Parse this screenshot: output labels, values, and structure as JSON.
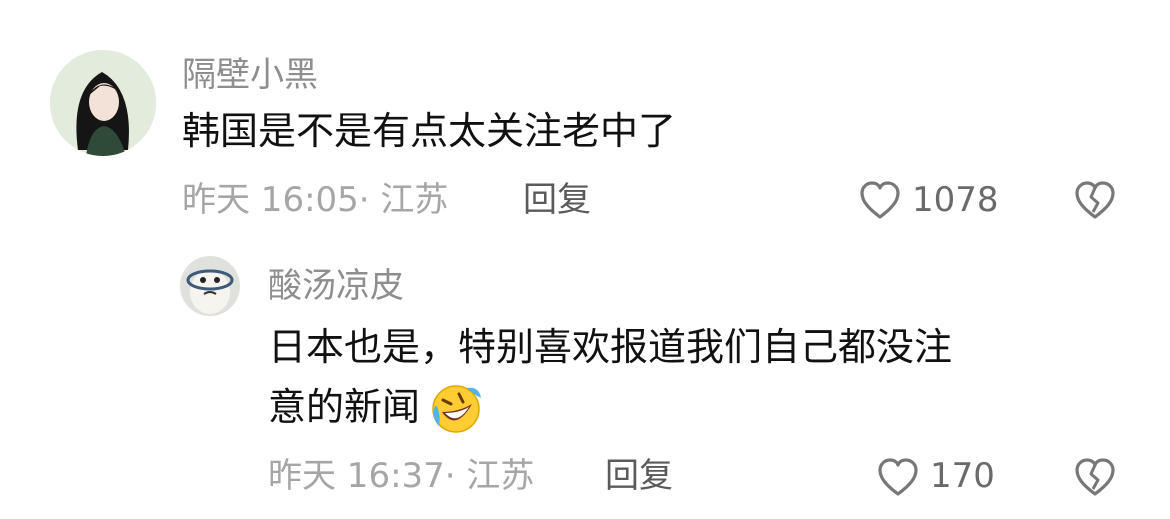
{
  "comments": [
    {
      "username": "隔壁小黑",
      "content": "韩国是不是有点太关注老中了",
      "time": "昨天 16:05",
      "location": "· 江苏",
      "reply_label": "回复",
      "likes": "1078"
    },
    {
      "username": "酸汤凉皮",
      "content_line1": "日本也是，特别喜欢报道我们自己都没注",
      "content_line2": "意的新闻",
      "emoji": "rolling-on-floor-laughing",
      "time": "昨天 16:37",
      "location": "· 江苏",
      "reply_label": "回复",
      "likes": "170"
    }
  ],
  "icons": {
    "like": "heart-outline-icon",
    "dislike": "broken-heart-icon"
  },
  "colors": {
    "username": "#8e8e8e",
    "text": "#111111",
    "meta": "#a6a6a6",
    "icon": "#777777"
  }
}
